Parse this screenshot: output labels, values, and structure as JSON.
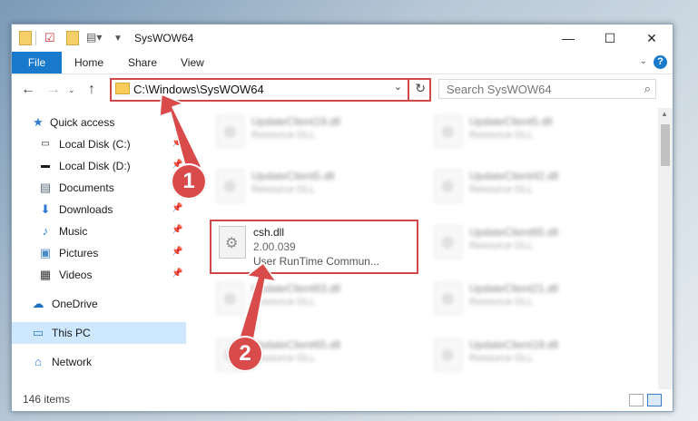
{
  "window": {
    "title": "SysWOW64"
  },
  "ribbon": {
    "tabs": [
      "File",
      "Home",
      "Share",
      "View"
    ],
    "help": "?"
  },
  "nav": {
    "address_path": "C:\\Windows\\SysWOW64",
    "search_placeholder": "Search SysWOW64"
  },
  "sidebar": {
    "items": [
      {
        "label": "Quick access",
        "icon": "star-icon",
        "pinned": false
      },
      {
        "label": "Local Disk (C:)",
        "icon": "drive-icon",
        "pinned": true
      },
      {
        "label": "Local Disk (D:)",
        "icon": "drive-icon",
        "pinned": true
      },
      {
        "label": "Documents",
        "icon": "documents-icon",
        "pinned": true
      },
      {
        "label": "Downloads",
        "icon": "downloads-icon",
        "pinned": true
      },
      {
        "label": "Music",
        "icon": "music-icon",
        "pinned": true
      },
      {
        "label": "Pictures",
        "icon": "pictures-icon",
        "pinned": true
      },
      {
        "label": "Videos",
        "icon": "videos-icon",
        "pinned": true
      },
      {
        "label": "OneDrive",
        "icon": "cloud-icon",
        "pinned": false
      },
      {
        "label": "This PC",
        "icon": "computer-icon",
        "pinned": false,
        "selected": true
      },
      {
        "label": "Network",
        "icon": "network-icon",
        "pinned": false
      }
    ]
  },
  "files": {
    "background": [
      {
        "name": "UpdateClient19.dll",
        "type": "Resource DLL"
      },
      {
        "name": "UpdateClient5.dll",
        "type": "Resource DLL"
      },
      {
        "name": "UpdateClient5.dll",
        "type": "Resource DLL"
      },
      {
        "name": "UpdateClient42.dll",
        "type": "Resource DLL"
      },
      {
        "name": "UpdateClient65.dll",
        "type": "Resource DLL"
      },
      {
        "name": "UpdateClient63.dll",
        "type": "Resource DLL"
      },
      {
        "name": "UpdateClient21.dll",
        "type": "Resource DLL"
      },
      {
        "name": "UpdateClient65.dll",
        "type": "Resource DLL"
      },
      {
        "name": "UpdateClient19.dll",
        "type": "Resource DLL"
      }
    ],
    "highlighted": {
      "name": "csh.dll",
      "version": "2.00.039",
      "description": "User RunTime Commun..."
    }
  },
  "status": {
    "item_count": "146 items"
  },
  "annotations": {
    "badge1": "1",
    "badge2": "2",
    "color": "#d94a4a"
  }
}
